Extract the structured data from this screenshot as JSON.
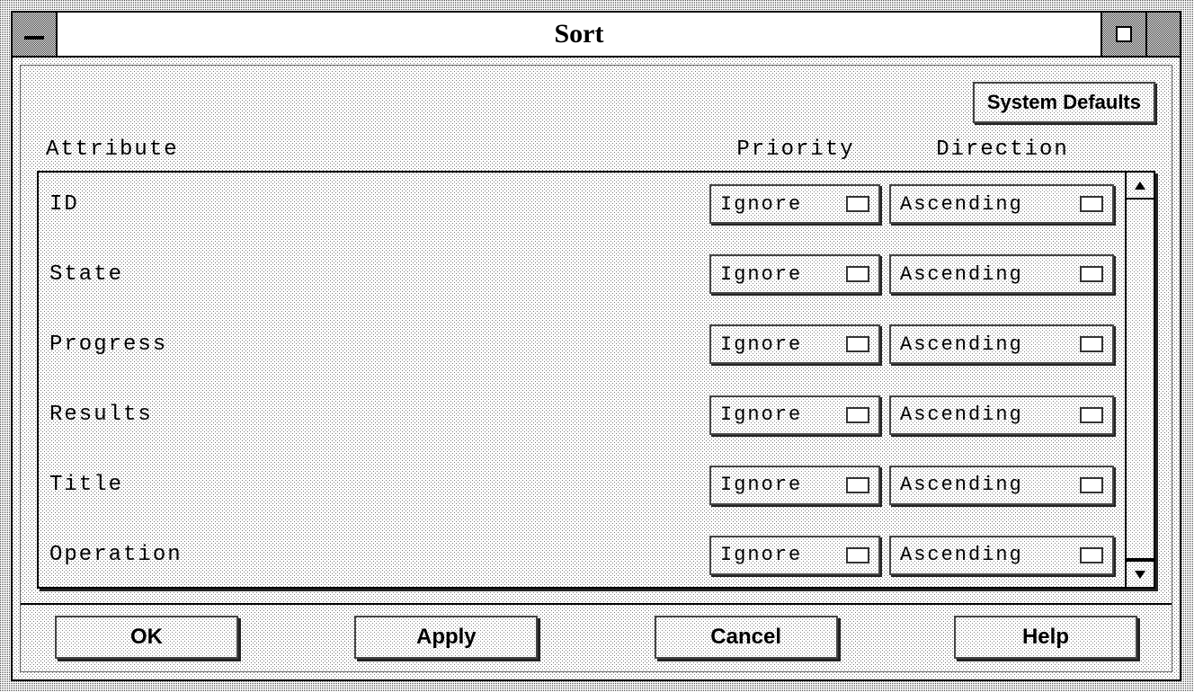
{
  "window": {
    "title": "Sort"
  },
  "systemDefaultsLabel": "System Defaults",
  "headers": {
    "attribute": "Attribute",
    "priority": "Priority",
    "direction": "Direction"
  },
  "rows": [
    {
      "attribute": "ID",
      "priority": "Ignore",
      "direction": "Ascending"
    },
    {
      "attribute": "State",
      "priority": "Ignore",
      "direction": "Ascending"
    },
    {
      "attribute": "Progress",
      "priority": "Ignore",
      "direction": "Ascending"
    },
    {
      "attribute": "Results",
      "priority": "Ignore",
      "direction": "Ascending"
    },
    {
      "attribute": "Title",
      "priority": "Ignore",
      "direction": "Ascending"
    },
    {
      "attribute": "Operation",
      "priority": "Ignore",
      "direction": "Ascending"
    }
  ],
  "actions": {
    "ok": "OK",
    "apply": "Apply",
    "cancel": "Cancel",
    "help": "Help"
  }
}
